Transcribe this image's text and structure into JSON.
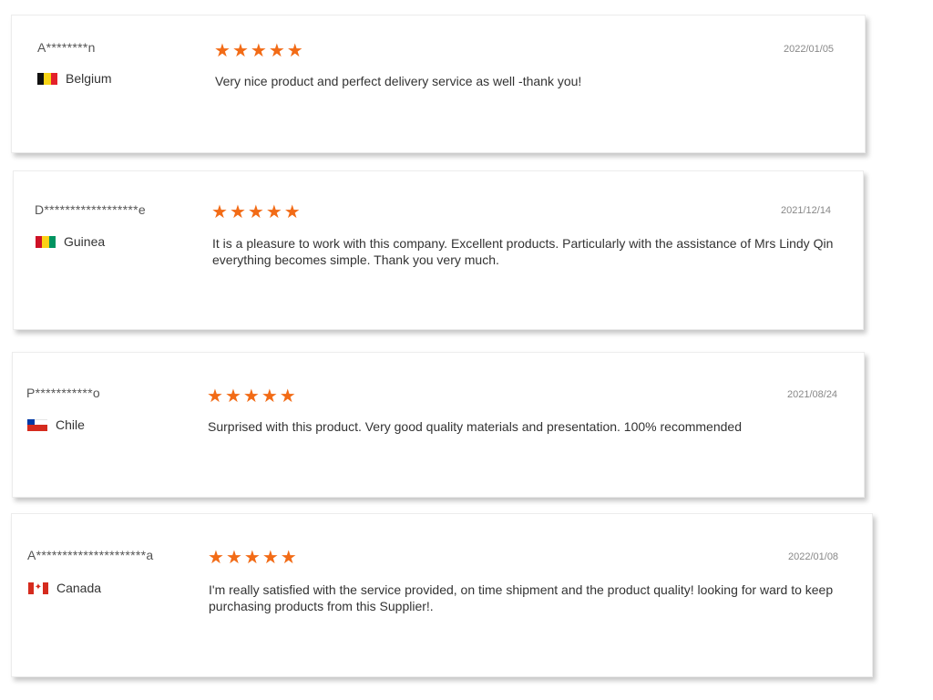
{
  "accent_color": "#f26b16",
  "star_icon": "★",
  "reviews": [
    {
      "reviewer": "A********n",
      "country": "Belgium",
      "flag": "belgium-flag-icon",
      "stars": 5,
      "date": "2022/01/05",
      "text": "Very nice product and perfect delivery service as well -thank you!"
    },
    {
      "reviewer": "D******************e",
      "country": "Guinea",
      "flag": "guinea-flag-icon",
      "stars": 5,
      "date": "2021/12/14",
      "text": "It is a pleasure to work with this company. Excellent products. Particularly with the assistance of Mrs Lindy Qin everything becomes simple. Thank you very much."
    },
    {
      "reviewer": "P***********o",
      "country": "Chile",
      "flag": "chile-flag-icon",
      "stars": 5,
      "date": "2021/08/24",
      "text": "Surprised with this product. Very good quality materials and presentation. 100% recommended"
    },
    {
      "reviewer": "A*********************a",
      "country": "Canada",
      "flag": "canada-flag-icon",
      "stars": 5,
      "date": "2022/01/08",
      "text": "I'm really satisfied with the service provided, on time shipment and the product quality! looking for ward to keep purchasing products from this Supplier!."
    }
  ]
}
